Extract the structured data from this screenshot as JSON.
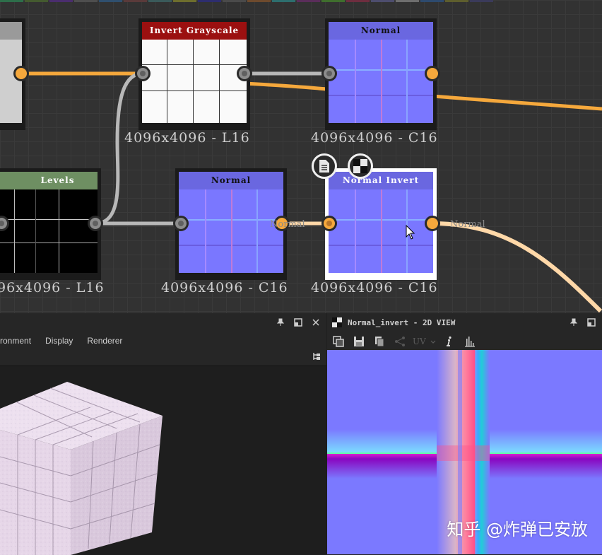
{
  "colors": {
    "graph_bg": "#323232",
    "wire_orange": "#f5a83c",
    "wire_gray": "#b0b0b0",
    "wire_light": "#ffd8a8",
    "header_red": "#9b1010",
    "header_green": "#6e8f62",
    "header_normal": "#6a67e0",
    "normal_map": "#7b79ff"
  },
  "swatch_colors": [
    "#2d6e4a",
    "#445a2f",
    "#4a2d6e",
    "#4e4e4e",
    "#2f4f6e",
    "#5a3a3a",
    "#3a5a5a",
    "#6e6e2d",
    "#2d2d6e",
    "#4a4a4a",
    "#6e4a2d",
    "#2d6e6e",
    "#5a2d5a",
    "#3f6e2d",
    "#6e2d3f",
    "#4d4d6e",
    "#6e6e6e",
    "#2d4a6e",
    "#5e5e2d",
    "#3a3a5a"
  ],
  "nodes": {
    "partial": {
      "resolution": ""
    },
    "invert_grayscale": {
      "title": "Invert Grayscale",
      "resolution": "4096x4096 - L16"
    },
    "normal_top": {
      "title": "Normal",
      "resolution": "4096x4096 - C16"
    },
    "levels": {
      "title": "Levels",
      "resolution": "96x4096 - L16"
    },
    "normal_bottom": {
      "title": "Normal",
      "resolution": "4096x4096 - C16",
      "port_label": "Normal"
    },
    "normal_invert": {
      "title": "Normal Invert",
      "resolution": "4096x4096 - C16",
      "port_label": "Normal"
    }
  },
  "node_tools": {
    "doc_icon": "document-icon",
    "checker_icon": "checker-icon"
  },
  "panel3d": {
    "menu": [
      "ronment",
      "Display",
      "Renderer"
    ],
    "icons": [
      "pin-icon",
      "float-icon",
      "close-icon",
      "tree-icon"
    ]
  },
  "panel2d": {
    "title": "Normal_invert - 2D VIEW",
    "toolbar": {
      "uv_label": "UV"
    },
    "icons": [
      "checker-icon",
      "pin-icon",
      "float-icon",
      "copy-icon",
      "save-icon",
      "paste-icon",
      "share-icon",
      "chevron-down-icon",
      "info-icon",
      "histogram-icon"
    ]
  },
  "watermark": "知乎 @炸弹已安放"
}
